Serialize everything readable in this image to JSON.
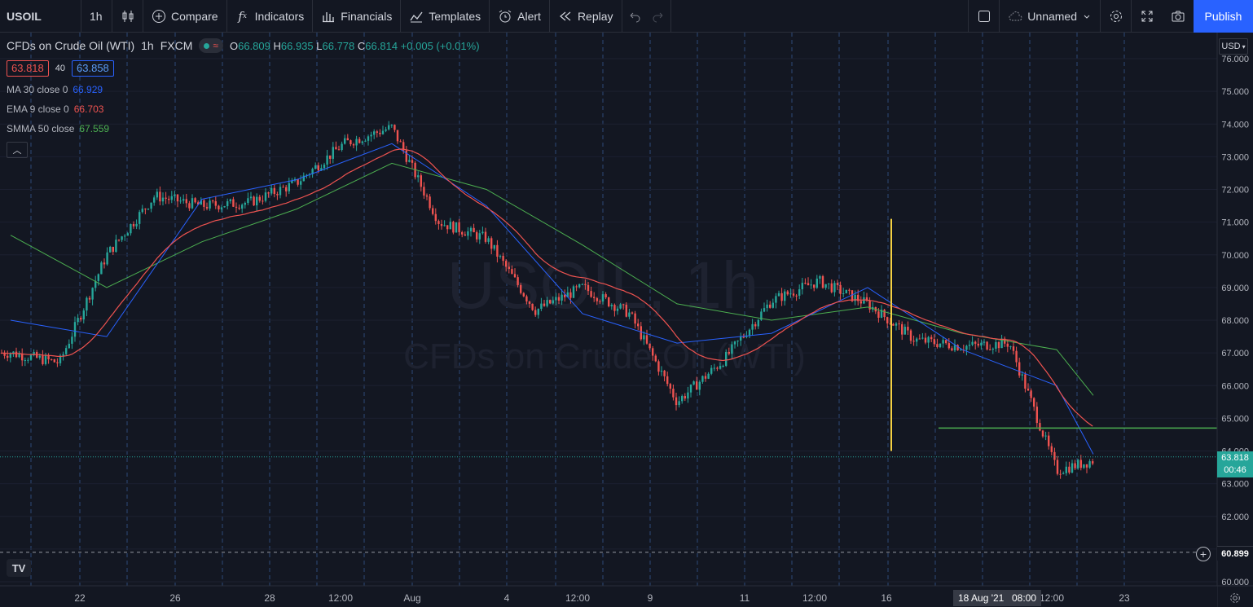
{
  "toolbar": {
    "symbol": "USOIL",
    "interval": "1h",
    "compare_label": "Compare",
    "indicators_label": "Indicators",
    "financials_label": "Financials",
    "templates_label": "Templates",
    "alert_label": "Alert",
    "replay_label": "Replay",
    "layout_name": "Unnamed",
    "publish_label": "Publish"
  },
  "legend": {
    "title": "CFDs on Crude Oil (WTI)",
    "interval": "1h",
    "exchange": "FXCM",
    "open_label": "O",
    "open": "66.809",
    "high_label": "H",
    "high": "66.935",
    "low_label": "L",
    "low": "66.778",
    "close_label": "C",
    "close": "66.814",
    "change": "+0.005 (+0.01%)",
    "sell_price": "63.818",
    "spread": "40",
    "buy_price": "63.858",
    "indicators": [
      {
        "label": "MA 30 close 0",
        "value": "66.929",
        "color": "#2962ff"
      },
      {
        "label": "EMA 9 close 0",
        "value": "66.703",
        "color": "#ef5350"
      },
      {
        "label": "SMMA 50 close",
        "value": "67.559",
        "color": "#4caf50"
      }
    ]
  },
  "watermark": {
    "symbol_line": "USOIL, 1h",
    "name_line": "CFDs on Crude Oil (WTI)"
  },
  "price_axis": {
    "currency": "USD",
    "ticks": [
      "76.000",
      "75.000",
      "74.000",
      "73.000",
      "72.000",
      "71.000",
      "70.000",
      "69.000",
      "68.000",
      "67.000",
      "66.000",
      "65.000",
      "64.000",
      "63.000",
      "62.000",
      "61.000",
      "60.000"
    ],
    "current_price": "63.818",
    "countdown": "00:46",
    "crosshair_price": "60.899"
  },
  "time_axis": {
    "ticks": [
      "22",
      "26",
      "28",
      "12:00",
      "Aug",
      "4",
      "12:00",
      "9",
      "11",
      "12:00",
      "16",
      "18 Aug '21",
      "08:00",
      "12:00",
      "23"
    ],
    "crosshair_date": "18 Aug '21",
    "crosshair_time": "08:00"
  },
  "colors": {
    "up": "#26a69a",
    "down": "#ef5350",
    "ma": "#2962ff",
    "ema": "#ef5350",
    "smma": "#4caf50",
    "vline": "#f5d142",
    "hline": "#4caf50",
    "accent": "#2962ff"
  },
  "chart_data": {
    "type": "line",
    "symbol": "USOIL",
    "interval": "1h",
    "ylim": [
      60,
      76
    ],
    "price_ticks": [
      76,
      75,
      74,
      73,
      72,
      71,
      70,
      69,
      68,
      67,
      66,
      65,
      64,
      63,
      62,
      61,
      60
    ],
    "series": [
      {
        "name": "Price",
        "x": [
          "Jul 20",
          "Jul 21",
          "Jul 22",
          "Jul 23",
          "Jul 26",
          "Jul 27",
          "Jul 28",
          "Jul 29",
          "Jul 30",
          "Aug 2",
          "Aug 3",
          "Aug 4",
          "Aug 5",
          "Aug 6",
          "Aug 9",
          "Aug 10",
          "Aug 11",
          "Aug 12",
          "Aug 13",
          "Aug 16",
          "Aug 17",
          "Aug 18",
          "Aug 19",
          "Aug 20"
        ],
        "values": [
          67.0,
          66.7,
          70.0,
          71.8,
          71.5,
          71.6,
          72.2,
          73.4,
          73.9,
          71.0,
          70.5,
          68.3,
          69.0,
          68.2,
          65.5,
          66.8,
          68.6,
          69.2,
          68.5,
          67.4,
          67.2,
          67.3,
          63.4,
          63.8
        ]
      },
      {
        "name": "MA 30 close 0",
        "x": [
          "Jul 20",
          "Jul 22",
          "Jul 26",
          "Jul 28",
          "Jul 30",
          "Aug 3",
          "Aug 5",
          "Aug 9",
          "Aug 11",
          "Aug 13",
          "Aug 17",
          "Aug 19",
          "Aug 20"
        ],
        "values": [
          68.0,
          67.5,
          71.7,
          72.3,
          73.4,
          71.5,
          68.2,
          67.3,
          67.6,
          69.0,
          67.1,
          66.0,
          63.9
        ]
      },
      {
        "name": "SMMA 50 close",
        "x": [
          "Jul 20",
          "Jul 22",
          "Jul 26",
          "Jul 28",
          "Jul 30",
          "Aug 3",
          "Aug 5",
          "Aug 9",
          "Aug 11",
          "Aug 13",
          "Aug 17",
          "Aug 19",
          "Aug 20"
        ],
        "values": [
          70.6,
          69.0,
          70.4,
          71.4,
          72.8,
          72.0,
          70.3,
          68.5,
          68.0,
          68.4,
          67.6,
          67.1,
          65.7
        ]
      }
    ],
    "annotations": {
      "vertical_line_date": "Aug 16",
      "horizontal_line_price": 64.7
    },
    "grid": true
  }
}
